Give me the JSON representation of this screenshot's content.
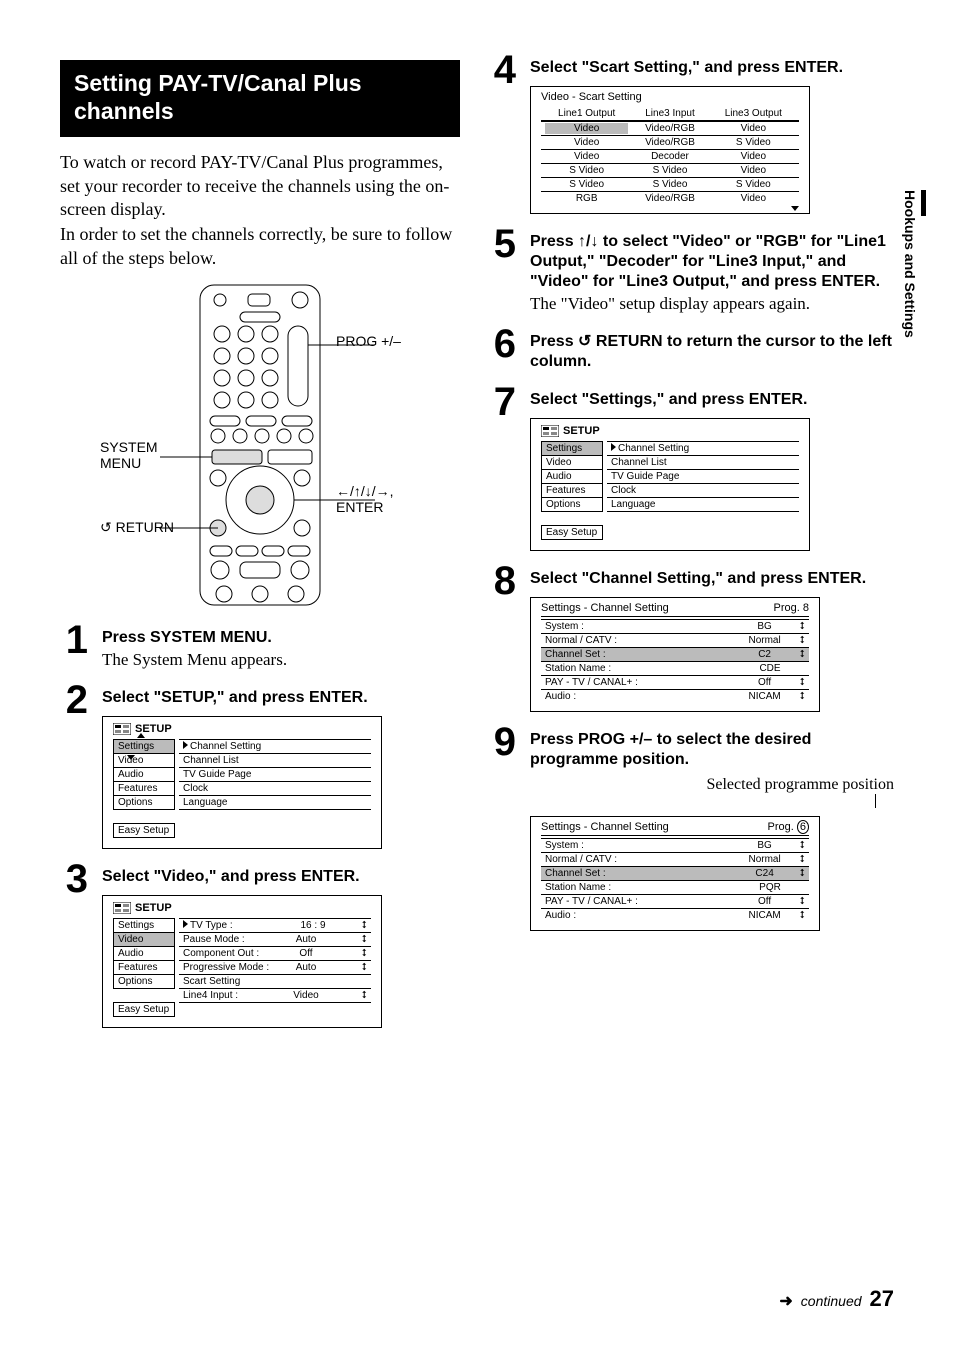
{
  "side_tab": "Hookups and Settings",
  "heading": "Setting PAY-TV/Canal Plus channels",
  "intro1": "To watch or record PAY-TV/Canal Plus programmes, set your recorder to receive the channels using the on-screen display.",
  "intro2": "In order to set the channels correctly, be sure to follow all of the steps below.",
  "remote_labels": {
    "prog": "PROG +/–",
    "system_menu": "SYSTEM MENU",
    "return": "RETURN",
    "arrows_enter": "←/↑/↓/→, ENTER"
  },
  "steps": {
    "s1": {
      "n": "1",
      "head": "Press SYSTEM MENU.",
      "sub": "The System Menu appears."
    },
    "s2": {
      "n": "2",
      "head": "Select \"SETUP,\" and press ENTER."
    },
    "s3": {
      "n": "3",
      "head": "Select \"Video,\" and press ENTER."
    },
    "s4": {
      "n": "4",
      "head": "Select \"Scart Setting,\" and press ENTER."
    },
    "s5": {
      "n": "5",
      "head": "Press ↑/↓ to select \"Video\" or \"RGB\" for \"Line1 Output,\" \"Decoder\" for \"Line3 Input,\" and \"Video\" for \"Line3 Output,\" and press ENTER.",
      "sub": "The \"Video\" setup display appears again."
    },
    "s6": {
      "n": "6",
      "head": "Press ↺ RETURN to return the cursor to the left column."
    },
    "s7": {
      "n": "7",
      "head": "Select \"Settings,\" and press ENTER."
    },
    "s8": {
      "n": "8",
      "head": "Select \"Channel Setting,\" and press ENTER."
    },
    "s9": {
      "n": "9",
      "head": "Press PROG +/– to select the desired programme position."
    }
  },
  "setup_window": {
    "title": "SETUP",
    "tabs": [
      "Settings",
      "Video",
      "Audio",
      "Features",
      "Options"
    ],
    "easy": "Easy Setup",
    "items": [
      "Channel Setting",
      "Channel List",
      "TV Guide Page",
      "Clock",
      "Language"
    ]
  },
  "video_window": {
    "rows": [
      {
        "label": "TV Type :",
        "val": "16 : 9"
      },
      {
        "label": "Pause Mode :",
        "val": "Auto"
      },
      {
        "label": "Component Out :",
        "val": "Off"
      },
      {
        "label": "Progressive Mode :",
        "val": "Auto"
      },
      {
        "label": "Scart Setting",
        "val": ""
      },
      {
        "label": "Line4 Input :",
        "val": "Video"
      }
    ]
  },
  "scart": {
    "title": "Video - Scart Setting",
    "headers": [
      "Line1 Output",
      "Line3 Input",
      "Line3 Output"
    ],
    "rows": [
      [
        "Video",
        "Video/RGB",
        "Video"
      ],
      [
        "Video",
        "Video/RGB",
        "S Video"
      ],
      [
        "Video",
        "Decoder",
        "Video"
      ],
      [
        "S Video",
        "S Video",
        "Video"
      ],
      [
        "S Video",
        "S Video",
        "S Video"
      ],
      [
        "RGB",
        "Video/RGB",
        "Video"
      ]
    ]
  },
  "chanset": {
    "title": "Settings - Channel Setting",
    "prog8": "Prog. 8",
    "rows": [
      {
        "label": "System :",
        "val": "BG"
      },
      {
        "label": "Normal / CATV :",
        "val": "Normal"
      },
      {
        "label": "Channel Set :",
        "val": "C2"
      },
      {
        "label": "Station Name :",
        "val": "CDE"
      },
      {
        "label": "PAY - TV / CANAL+ :",
        "val": "Off"
      },
      {
        "label": "Audio :",
        "val": "NICAM"
      }
    ]
  },
  "sel_prog_label": "Selected programme position",
  "chanset2": {
    "title": "Settings - Channel Setting",
    "prog": "Prog.",
    "prognum": "6",
    "rows": [
      {
        "label": "System :",
        "val": "BG"
      },
      {
        "label": "Normal / CATV :",
        "val": "Normal"
      },
      {
        "label": "Channel Set :",
        "val": "C24"
      },
      {
        "label": "Station Name :",
        "val": "PQR"
      },
      {
        "label": "PAY - TV / CANAL+ :",
        "val": "Off"
      },
      {
        "label": "Audio :",
        "val": "NICAM"
      }
    ]
  },
  "footer": {
    "continued": "continued",
    "page": "27"
  }
}
